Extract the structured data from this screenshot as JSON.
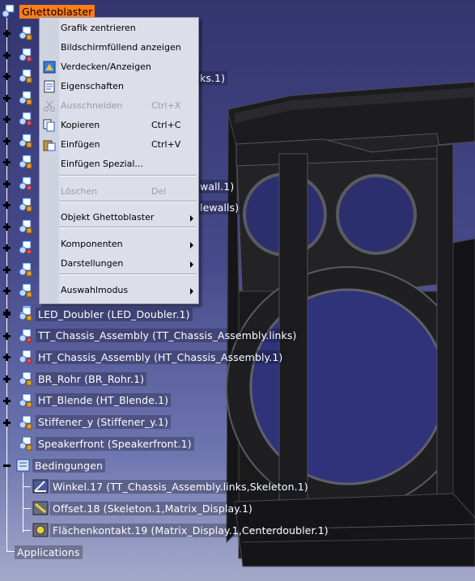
{
  "colors": {
    "background_top": "#34356f",
    "background_bottom": "#a5a9c9",
    "selection": "#ff7d1a",
    "menu_background": "#dcdfe9"
  },
  "tree": {
    "root_label": "Ghettoblaster",
    "hidden_suffixes": [
      "ks.1)",
      "wall.1)",
      "lewalls)"
    ],
    "items": [
      {
        "label": "LED_Doubler (LED_Doubler.1)",
        "icon": "part-icon"
      },
      {
        "label": "TT_Chassis_Assembly (TT_Chassis_Assembly.links)",
        "icon": "assembly-icon"
      },
      {
        "label": "HT_Chassis_Assembly (HT_Chassis_Assembly.1)",
        "icon": "assembly-icon"
      },
      {
        "label": "BR_Rohr (BR_Rohr.1)",
        "icon": "part-icon"
      },
      {
        "label": "HT_Blende (HT_Blende.1)",
        "icon": "part-icon"
      },
      {
        "label": "Stiffener_y (Stiffener_y.1)",
        "icon": "part-icon"
      },
      {
        "label": "Speakerfront (Speakerfront.1)",
        "icon": "part-icon"
      }
    ],
    "constraints": {
      "label": "Bedingungen",
      "items": [
        {
          "label": "Winkel.17 (TT_Chassis_Assembly.links,Skeleton.1)",
          "icon": "angle-constraint-icon"
        },
        {
          "label": "Offset.18 (Skeleton.1,Matrix_Display.1)",
          "icon": "offset-constraint-icon"
        },
        {
          "label": "Flächenkontakt.19 (Matrix_Display.1,Centerdoubler.1)",
          "icon": "contact-constraint-icon"
        }
      ]
    },
    "applications_label": "Applications"
  },
  "context_menu": {
    "items": [
      {
        "label": "Grafik zentrieren",
        "shortcut": "",
        "disabled": false,
        "submenu": false,
        "icon": ""
      },
      {
        "label": "Bildschirmfüllend anzeigen",
        "shortcut": "",
        "disabled": false,
        "submenu": false,
        "icon": ""
      },
      {
        "label": "Verdecken/Anzeigen",
        "shortcut": "",
        "disabled": false,
        "submenu": false,
        "icon": "hide-show-icon"
      },
      {
        "label": "Eigenschaften",
        "shortcut": "",
        "disabled": false,
        "submenu": false,
        "icon": "properties-icon"
      },
      {
        "label": "Ausschneiden",
        "shortcut": "Ctrl+X",
        "disabled": true,
        "submenu": false,
        "icon": "scissors-icon"
      },
      {
        "label": "Kopieren",
        "shortcut": "Ctrl+C",
        "disabled": false,
        "submenu": false,
        "icon": "copy-icon"
      },
      {
        "label": "Einfügen",
        "shortcut": "Ctrl+V",
        "disabled": false,
        "submenu": false,
        "icon": "paste-icon"
      },
      {
        "label": "Einfügen Spezial...",
        "shortcut": "",
        "disabled": false,
        "submenu": false,
        "icon": ""
      },
      {
        "label": "Löschen",
        "shortcut": "Del",
        "disabled": true,
        "submenu": false,
        "icon": ""
      },
      {
        "label": "Objekt Ghettoblaster",
        "shortcut": "",
        "disabled": false,
        "submenu": true,
        "icon": ""
      },
      {
        "label": "Komponenten",
        "shortcut": "",
        "disabled": false,
        "submenu": true,
        "icon": ""
      },
      {
        "label": "Darstellungen",
        "shortcut": "",
        "disabled": false,
        "submenu": true,
        "icon": ""
      },
      {
        "label": "Auswahlmodus",
        "shortcut": "",
        "disabled": false,
        "submenu": true,
        "icon": ""
      }
    ]
  }
}
